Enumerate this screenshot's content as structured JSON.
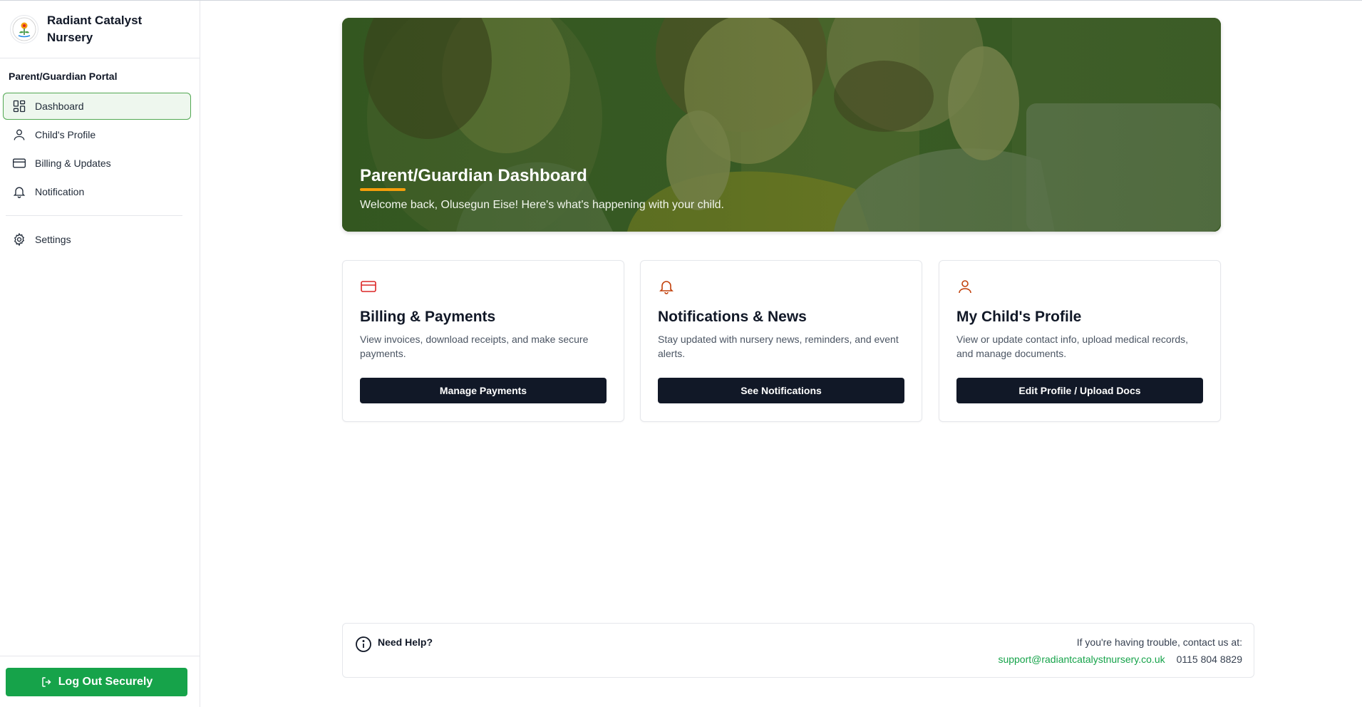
{
  "brand": {
    "name": "Radiant Catalyst Nursery"
  },
  "sidebar": {
    "section_label": "Parent/Guardian Portal",
    "items": [
      {
        "label": "Dashboard",
        "icon": "dashboard-grid-icon",
        "active": true
      },
      {
        "label": "Child's Profile",
        "icon": "user-icon",
        "active": false
      },
      {
        "label": "Billing & Updates",
        "icon": "credit-card-icon",
        "active": false
      },
      {
        "label": "Notification",
        "icon": "bell-icon",
        "active": false
      }
    ],
    "settings": {
      "label": "Settings",
      "icon": "gear-icon"
    },
    "logout_label": "Log Out Securely"
  },
  "hero": {
    "title": "Parent/Guardian Dashboard",
    "subtitle": "Welcome back, Olusegun Eise! Here's what's happening with your child."
  },
  "cards": [
    {
      "icon": "credit-card-icon",
      "icon_color": "#dc2626",
      "title": "Billing & Payments",
      "description": "View invoices, download receipts, and make secure payments.",
      "button": "Manage Payments"
    },
    {
      "icon": "bell-icon",
      "icon_color": "#c2410c",
      "title": "Notifications & News",
      "description": "Stay updated with nursery news, reminders, and event alerts.",
      "button": "See Notifications"
    },
    {
      "icon": "user-icon",
      "icon_color": "#c2410c",
      "title": "My Child's Profile",
      "description": "View or update contact info, upload medical records, and manage documents.",
      "button": "Edit Profile / Upload Docs"
    }
  ],
  "help": {
    "title": "Need Help?",
    "contact_label": "If you're having trouble, contact us at:",
    "email": "support@radiantcatalystnursery.co.uk",
    "phone": "0115 804 8829"
  },
  "colors": {
    "accent_green": "#16a34a",
    "dark_button": "#111827",
    "hero_green": "#3f5e2c",
    "underline_orange": "#f59e0b"
  }
}
